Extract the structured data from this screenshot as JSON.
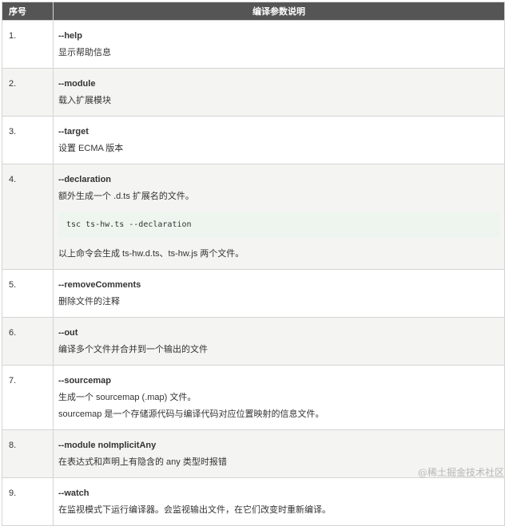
{
  "table": {
    "headers": {
      "no": "序号",
      "desc": "编译参数说明"
    },
    "rows": [
      {
        "no": "1.",
        "option": "--help",
        "lines": [
          "显示帮助信息"
        ]
      },
      {
        "no": "2.",
        "option": "--module",
        "lines": [
          "载入扩展模块"
        ]
      },
      {
        "no": "3.",
        "option": "--target",
        "lines": [
          "设置 ECMA 版本"
        ]
      },
      {
        "no": "4.",
        "option": "--declaration",
        "line1": "额外生成一个 .d.ts 扩展名的文件。",
        "code": "tsc ts-hw.ts --declaration",
        "line2": "以上命令会生成 ts-hw.d.ts、ts-hw.js 两个文件。"
      },
      {
        "no": "5.",
        "option": "--removeComments",
        "lines": [
          "删除文件的注释"
        ]
      },
      {
        "no": "6.",
        "option": "--out",
        "lines": [
          "编译多个文件并合并到一个输出的文件"
        ]
      },
      {
        "no": "7.",
        "option": "--sourcemap",
        "lines": [
          "生成一个 sourcemap (.map) 文件。",
          "sourcemap 是一个存储源代码与编译代码对应位置映射的信息文件。"
        ]
      },
      {
        "no": "8.",
        "option": "--module noImplicitAny",
        "lines": [
          "在表达式和声明上有隐含的 any 类型时报错"
        ]
      },
      {
        "no": "9.",
        "option": "--watch",
        "lines": [
          "在监视模式下运行编译器。会监视输出文件，在它们改变时重新编译。"
        ]
      }
    ]
  },
  "watermark": "@稀土掘金技术社区",
  "colors": {
    "header_bg": "#555555",
    "stripe_bg": "#f4f4f2",
    "code_bg": "#eef5ee",
    "border": "#d4d4d4"
  }
}
